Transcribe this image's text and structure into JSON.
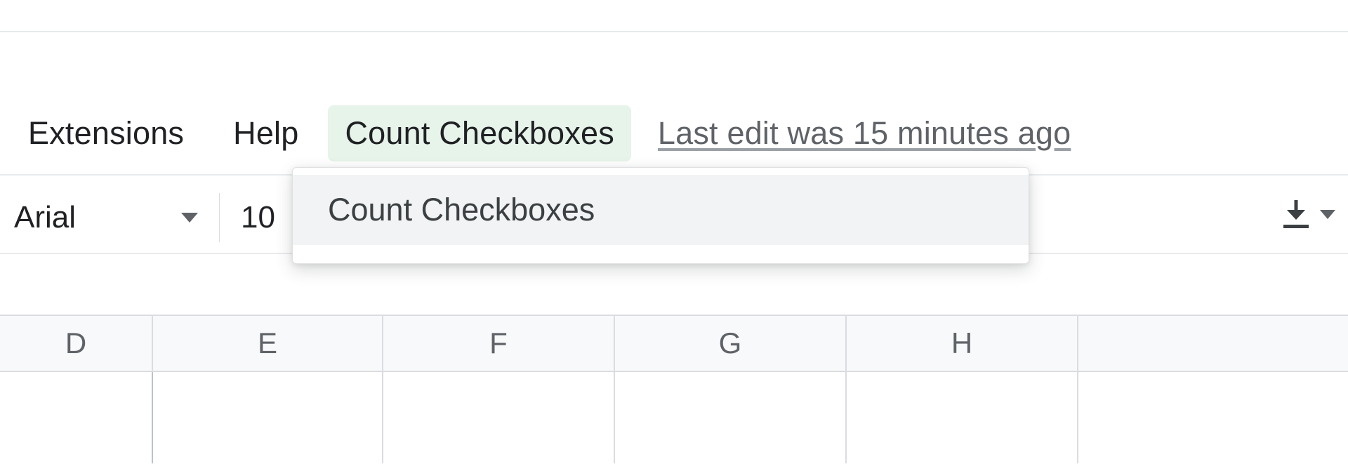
{
  "menubar": {
    "extensions": "Extensions",
    "help": "Help",
    "count_checkboxes": "Count Checkboxes",
    "last_edit": "Last edit was 15 minutes ago"
  },
  "toolbar": {
    "font_family": "Arial",
    "font_size_partial": "10"
  },
  "dropdown": {
    "count_checkboxes_item": "Count Checkboxes"
  },
  "columns": {
    "d": "D",
    "e": "E",
    "f": "F",
    "g": "G",
    "h": "H"
  }
}
